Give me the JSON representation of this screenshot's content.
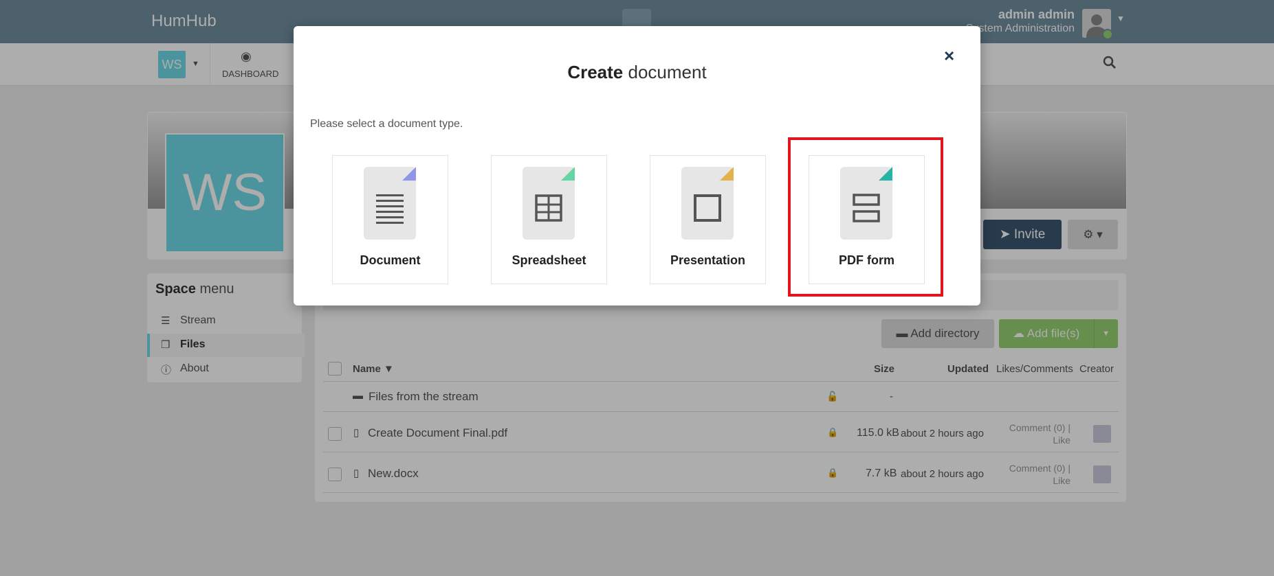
{
  "app": {
    "brand": "HumHub"
  },
  "user": {
    "name": "admin admin",
    "role": "System Administration"
  },
  "subnav": {
    "space_badge": "WS",
    "dashboard_label": "DASHBOARD"
  },
  "space": {
    "badge": "WS",
    "invite_label": "Invite"
  },
  "space_menu": {
    "title_bold": "Space",
    "title_rest": " menu",
    "items": [
      {
        "label": "Stream",
        "icon": "list-icon"
      },
      {
        "label": "Files",
        "icon": "copy-icon",
        "active": true
      },
      {
        "label": "About",
        "icon": "info-icon"
      }
    ]
  },
  "files": {
    "add_directory_label": "Add directory",
    "add_files_label": "Add file(s)",
    "columns": {
      "name": "Name ▼",
      "size": "Size",
      "updated": "Updated",
      "likes": "Likes/Comments",
      "creator": "Creator"
    },
    "rows": [
      {
        "name": "Files from the stream",
        "size": "-",
        "updated": "",
        "comment": "",
        "like": ""
      },
      {
        "name": "Create Document Final.pdf",
        "size": "115.0 kB",
        "updated": "about 2 hours ago",
        "comment": "Comment (0) |",
        "like": "Like"
      },
      {
        "name": "New.docx",
        "size": "7.7 kB",
        "updated": "about 2 hours ago",
        "comment": "Comment (0) |",
        "like": "Like"
      }
    ]
  },
  "modal": {
    "title_bold": "Create",
    "title_rest": " document",
    "close": "×",
    "hint": "Please select a document type.",
    "types": [
      {
        "label": "Document",
        "fold_color": "#8f97e6"
      },
      {
        "label": "Spreadsheet",
        "fold_color": "#66d4a3"
      },
      {
        "label": "Presentation",
        "fold_color": "#e4b24c"
      },
      {
        "label": "PDF form",
        "fold_color": "#27b3a6"
      }
    ]
  }
}
